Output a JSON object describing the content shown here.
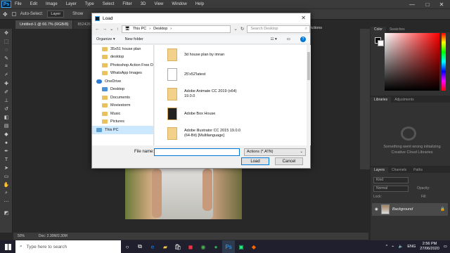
{
  "menubar": {
    "logo": "Ps",
    "items": [
      "File",
      "Edit",
      "Image",
      "Layer",
      "Type",
      "Select",
      "Filter",
      "3D",
      "View",
      "Window",
      "Help"
    ],
    "minimize": "—",
    "maximize": "□",
    "close": "✕"
  },
  "optbar": {
    "auto_select": "Auto-Select:",
    "auto_select_value": "Layer",
    "show": "Show"
  },
  "doctabs": [
    "Untitled-1 @ 66.7% (RGB/8)",
    "852426"
  ],
  "canvas_tab_right": "Actions",
  "statusbar": {
    "zoom": "50%",
    "doc": "Doc: 2.30M/2.30M"
  },
  "panels": {
    "color_tabs": [
      "Color",
      "Swatches"
    ],
    "libraries_tabs": [
      "Libraries",
      "Adjustments"
    ],
    "libraries_message": "Something went wrong initializing Creative Cloud Libraries",
    "layers_tabs": [
      "Layers",
      "Channels",
      "Paths"
    ],
    "layers_kind": "Kind",
    "layers_mode": "Normal",
    "layers_opacity": "Opacity:",
    "layers_lock": "Lock:",
    "layers_fill": "Fill:",
    "layer_name": "Background"
  },
  "dialog": {
    "title": "Load",
    "close": "✕",
    "path": [
      "This PC",
      "Desktop"
    ],
    "search_placeholder": "Search Desktop",
    "organize": "Organize ▾",
    "new_folder": "New folder",
    "nav_items": [
      {
        "label": "35x51 house plan",
        "icon": "folder"
      },
      {
        "label": "desktop",
        "icon": "folder"
      },
      {
        "label": "Photoshop Action Free D",
        "icon": "folder"
      },
      {
        "label": "WhatsApp Images",
        "icon": "folder"
      },
      {
        "label": "OneDrive",
        "icon": "cloud"
      },
      {
        "label": "Desktop",
        "icon": "blue"
      },
      {
        "label": "Documents",
        "icon": "folder"
      },
      {
        "label": "Moviestorm",
        "icon": "folder"
      },
      {
        "label": "Music",
        "icon": "folder"
      },
      {
        "label": "Pictures",
        "icon": "folder"
      },
      {
        "label": "This PC",
        "icon": "pc"
      }
    ],
    "files": [
      {
        "name": "3d house plan by imran",
        "sub": "",
        "icon": "folder"
      },
      {
        "name": "25'x52'latest",
        "sub": "",
        "icon": "doc"
      },
      {
        "name": "Adobe Animate CC 2019 (x64)",
        "sub": "19.0.0",
        "icon": "folder"
      },
      {
        "name": "Adobe Box House",
        "sub": "",
        "icon": "dark"
      },
      {
        "name": "Adobe Illustrator CC 2015 19.0.0",
        "sub": "(64-Bit) [Multilanguage]",
        "icon": "folder"
      }
    ],
    "file_name_label": "File name:",
    "file_name_value": "",
    "file_type": "Actions (*.ATN)",
    "load_button": "Load",
    "cancel_button": "Cancel"
  },
  "taskbar": {
    "search_placeholder": "Type here to search",
    "lang": "ENG",
    "time": "2:56 PM",
    "date": "27/06/2020"
  }
}
